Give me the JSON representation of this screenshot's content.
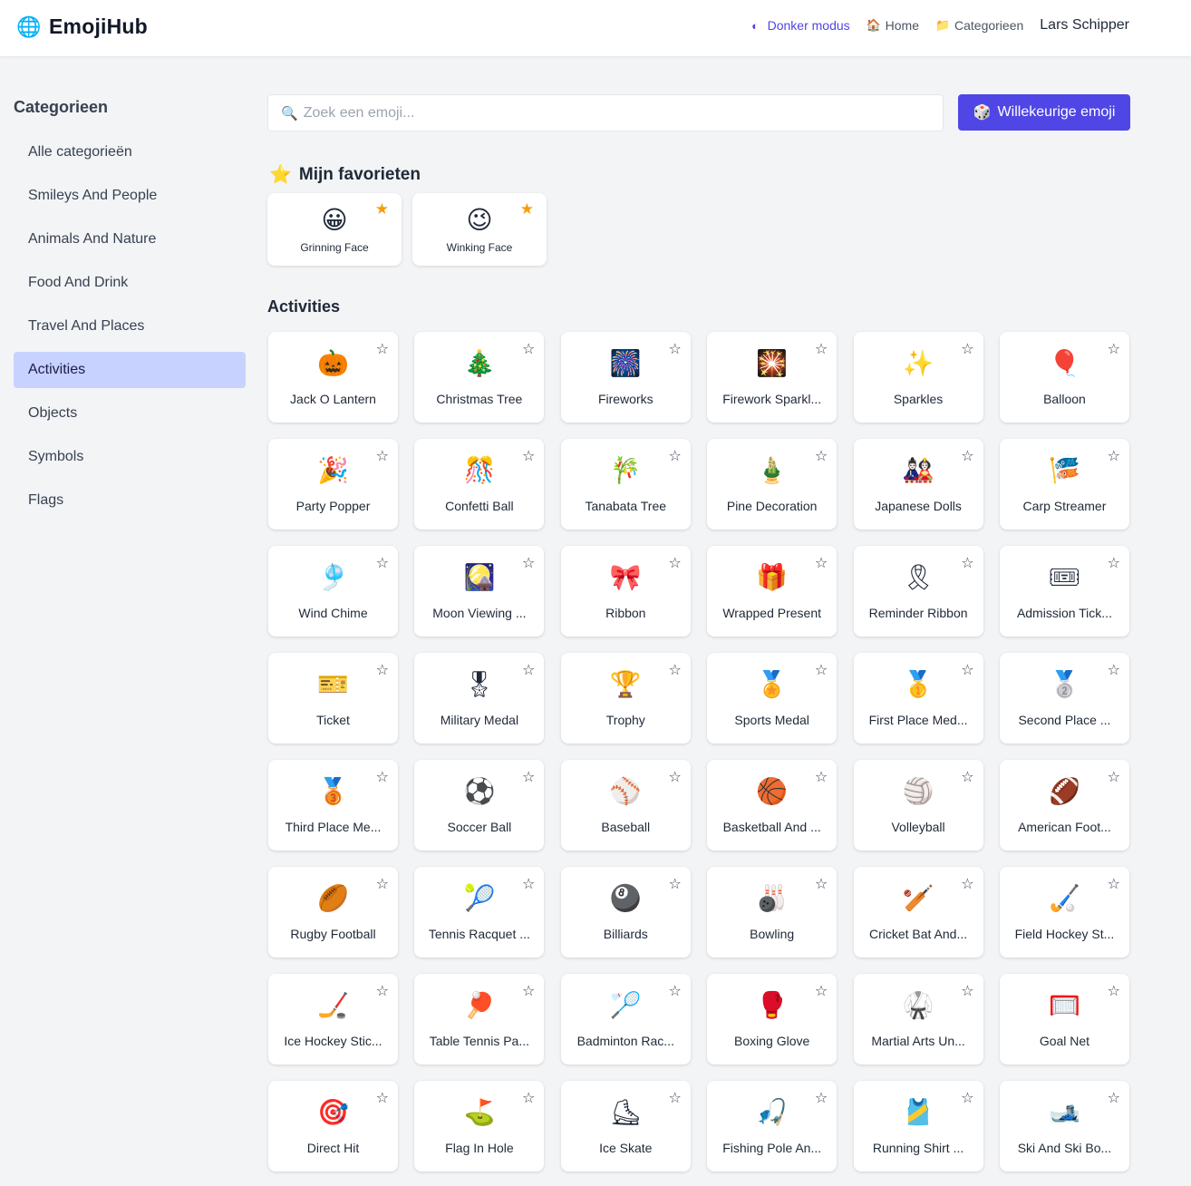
{
  "header": {
    "brand": "EmojiHub",
    "brand_icon": "🌐",
    "nav": {
      "dark_mode": "Donker modus",
      "home": "Home",
      "categories": "Categorieen",
      "user": "Lars Schipper"
    },
    "icons": {
      "dark_mode": "◐",
      "home": "🏠",
      "categories": "📁"
    }
  },
  "sidebar": {
    "title": "Categorieen",
    "items": [
      {
        "label": "Alle categorieën"
      },
      {
        "label": "Smileys And People"
      },
      {
        "label": "Animals And Nature"
      },
      {
        "label": "Food And Drink"
      },
      {
        "label": "Travel And Places"
      },
      {
        "label": "Activities",
        "active": true
      },
      {
        "label": "Objects"
      },
      {
        "label": "Symbols"
      },
      {
        "label": "Flags"
      }
    ]
  },
  "search": {
    "placeholder": "Zoek een emoji...",
    "value": "",
    "icon": "🔍"
  },
  "random_button": {
    "label": "Willekeurige emoji",
    "icon": "🎲"
  },
  "favorites": {
    "title": "Mijn favorieten",
    "icon": "⭐",
    "items": [
      {
        "emoji": "😀",
        "name": "Grinning Face"
      },
      {
        "emoji": "😉",
        "name": "Winking Face"
      }
    ]
  },
  "section": {
    "title": "Activities"
  },
  "emojis": [
    {
      "emoji": "🎃",
      "name": "Jack O Lantern"
    },
    {
      "emoji": "🎄",
      "name": "Christmas Tree"
    },
    {
      "emoji": "🎆",
      "name": "Fireworks"
    },
    {
      "emoji": "🎇",
      "name": "Firework Sparkl..."
    },
    {
      "emoji": "✨",
      "name": "Sparkles"
    },
    {
      "emoji": "🎈",
      "name": "Balloon"
    },
    {
      "emoji": "🎉",
      "name": "Party Popper"
    },
    {
      "emoji": "🎊",
      "name": "Confetti Ball"
    },
    {
      "emoji": "🎋",
      "name": "Tanabata Tree"
    },
    {
      "emoji": "🎍",
      "name": "Pine Decoration"
    },
    {
      "emoji": "🎎",
      "name": "Japanese Dolls"
    },
    {
      "emoji": "🎏",
      "name": "Carp Streamer"
    },
    {
      "emoji": "🎐",
      "name": "Wind Chime"
    },
    {
      "emoji": "🎑",
      "name": "Moon Viewing ..."
    },
    {
      "emoji": "🎀",
      "name": "Ribbon"
    },
    {
      "emoji": "🎁",
      "name": "Wrapped Present"
    },
    {
      "emoji": "🎗",
      "name": "Reminder Ribbon"
    },
    {
      "emoji": "🎟",
      "name": "Admission Tick..."
    },
    {
      "emoji": "🎫",
      "name": "Ticket"
    },
    {
      "emoji": "🎖",
      "name": "Military Medal"
    },
    {
      "emoji": "🏆",
      "name": "Trophy"
    },
    {
      "emoji": "🏅",
      "name": "Sports Medal"
    },
    {
      "emoji": "🥇",
      "name": "First Place Med..."
    },
    {
      "emoji": "🥈",
      "name": "Second Place ..."
    },
    {
      "emoji": "🥉",
      "name": "Third Place Me..."
    },
    {
      "emoji": "⚽",
      "name": "Soccer Ball"
    },
    {
      "emoji": "⚾",
      "name": "Baseball"
    },
    {
      "emoji": "🏀",
      "name": "Basketball And ..."
    },
    {
      "emoji": "🏐",
      "name": "Volleyball"
    },
    {
      "emoji": "🏈",
      "name": "American Foot..."
    },
    {
      "emoji": "🏉",
      "name": "Rugby Football"
    },
    {
      "emoji": "🎾",
      "name": "Tennis Racquet ..."
    },
    {
      "emoji": "🎱",
      "name": "Billiards"
    },
    {
      "emoji": "🎳",
      "name": "Bowling"
    },
    {
      "emoji": "🏏",
      "name": "Cricket Bat And..."
    },
    {
      "emoji": "🏑",
      "name": "Field Hockey St..."
    },
    {
      "emoji": "🏒",
      "name": "Ice Hockey Stic..."
    },
    {
      "emoji": "🏓",
      "name": "Table Tennis Pa..."
    },
    {
      "emoji": "🏸",
      "name": "Badminton Rac..."
    },
    {
      "emoji": "🥊",
      "name": "Boxing Glove"
    },
    {
      "emoji": "🥋",
      "name": "Martial Arts Un..."
    },
    {
      "emoji": "🥅",
      "name": "Goal Net"
    },
    {
      "emoji": "🎯",
      "name": "Direct Hit"
    },
    {
      "emoji": "⛳",
      "name": "Flag In Hole"
    },
    {
      "emoji": "⛸",
      "name": "Ice Skate"
    },
    {
      "emoji": "🎣",
      "name": "Fishing Pole An..."
    },
    {
      "emoji": "🎽",
      "name": "Running Shirt ..."
    },
    {
      "emoji": "🎿",
      "name": "Ski And Ski Bo..."
    }
  ],
  "star_outline": "☆",
  "star_filled": "★",
  "colors": {
    "accent": "#4f46e5",
    "active_category_bg": "#c7d2fe",
    "favorite_star": "#f59e0b",
    "background": "#f3f4f6"
  }
}
